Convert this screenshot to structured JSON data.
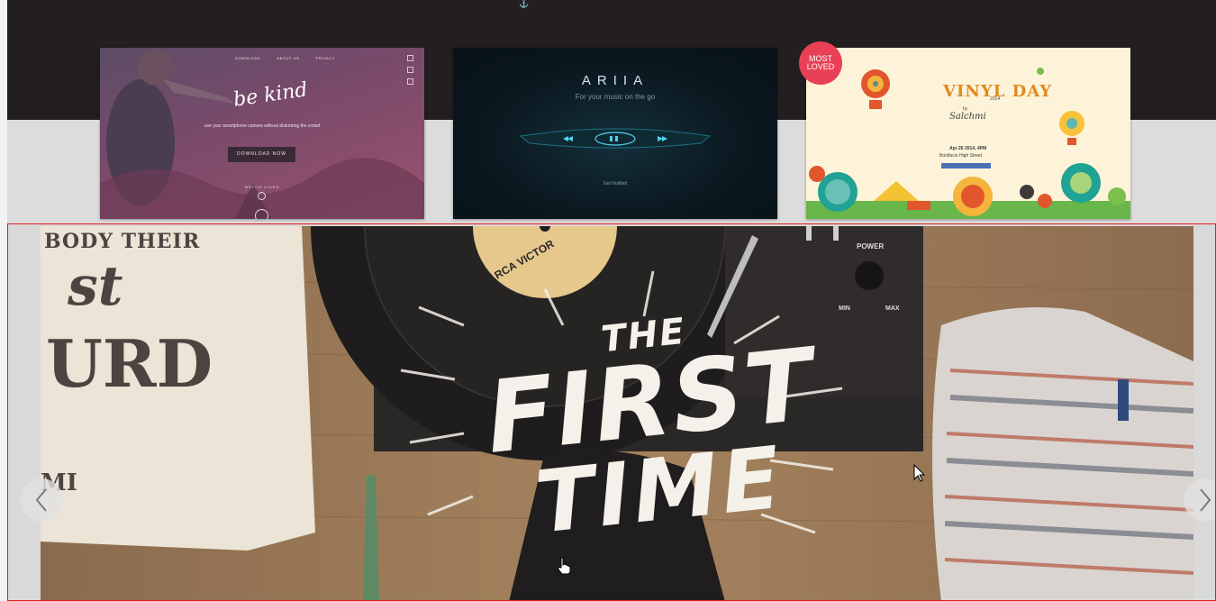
{
  "gallery": {
    "cards": [
      {
        "id": "bekind",
        "nav": [
          "DOWNLOAD",
          "ABOUT US",
          "PRIVACY"
        ],
        "logo": "be kind",
        "tagline": "use your smartphone camera without disturbing the crowd",
        "cta": "DOWNLOAD NOW",
        "watch": "WATCH VIDEO"
      },
      {
        "id": "ariia",
        "title": "ARIIA",
        "subtitle": "For your music on the go",
        "notified": "Get Notified"
      },
      {
        "id": "vinyl",
        "badge_line1": "MOST",
        "badge_line2": "LOVED",
        "title": "VINYL DAY",
        "year": "2014",
        "by": "by",
        "brand": "Salchmi",
        "date": "Apr 26 2014, 4PM",
        "venue": "Bonifacio High Street"
      }
    ]
  },
  "hero": {
    "line1": "THE",
    "line2": "FIRST",
    "line3": "TIME",
    "tee_a": "BODY THEIR",
    "tee_b": "st",
    "tee_c": "URD",
    "tee_d": "MI",
    "amp_power": "POWER",
    "amp_min": "MIN",
    "amp_max": "MAX",
    "record_label": "RCA VICTOR"
  },
  "colors": {
    "badge": "#e94056",
    "frame": "#e01b1b",
    "top_band": "#231f20"
  }
}
